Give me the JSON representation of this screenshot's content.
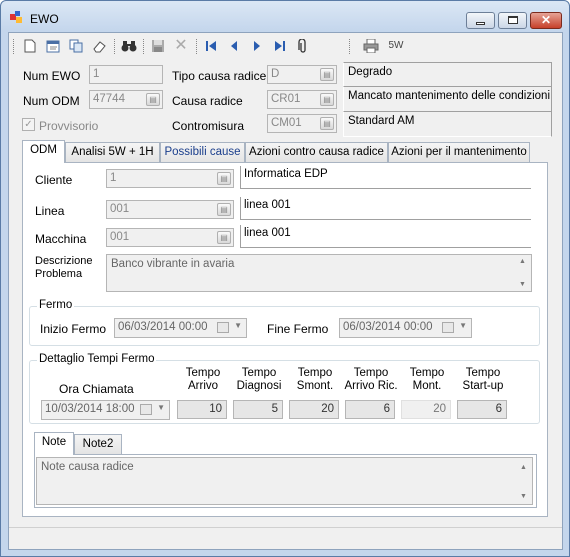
{
  "window": {
    "title": "EWO",
    "accent": "#c7402a"
  },
  "toolbar": {
    "tools": [
      "new-icon",
      "edit-icon",
      "copy-icon",
      "eraser-icon",
      "binoculars-icon",
      "save-icon",
      "delete-icon",
      "first-icon",
      "prev-icon",
      "next-icon",
      "last-icon",
      "attach-icon",
      "printer-icon"
    ],
    "fivew_label": "5W"
  },
  "header": {
    "num_ewo_label": "Num EWO",
    "num_ewo_value": "1",
    "num_odm_label": "Num ODM",
    "num_odm_value": "47744",
    "provvisorio_label": "Provvisorio",
    "tipo_causa_label": "Tipo causa radice",
    "tipo_causa_code": "D",
    "tipo_causa_desc": "Degrado",
    "causa_label": "Causa radice",
    "causa_code": "CR01",
    "causa_desc": "Mancato mantenimento delle condizioni di",
    "contromisura_label": "Contromisura",
    "contromisura_code": "CM01",
    "contromisura_desc": "Standard AM"
  },
  "tabs": [
    "ODM",
    "Analisi 5W + 1H",
    "Possibili cause",
    "Azioni contro causa radice",
    "Azioni per il mantenimento"
  ],
  "odm": {
    "cliente_label": "Cliente",
    "cliente_code": "1",
    "cliente_desc": "Informatica EDP",
    "linea_label": "Linea",
    "linea_code": "001",
    "linea_desc": "linea 001",
    "macchina_label": "Macchina",
    "macchina_code": "001",
    "macchina_desc": "linea 001",
    "descrizione_label_1": "Descrizione",
    "descrizione_label_2": "Problema",
    "descrizione_value": "Banco vibrante in avaria"
  },
  "fermo": {
    "title": "Fermo",
    "inizio_label": "Inizio Fermo",
    "inizio_value": "06/03/2014 00:00",
    "fine_label": "Fine Fermo",
    "fine_value": "06/03/2014 00:00"
  },
  "tempi": {
    "title": "Dettaglio Tempi Fermo",
    "ora_label": "Ora Chiamata",
    "ora_value": "10/03/2014 18:00",
    "columns": [
      {
        "l1": "Tempo",
        "l2": "Arrivo",
        "value": "10"
      },
      {
        "l1": "Tempo",
        "l2": "Diagnosi",
        "value": "5"
      },
      {
        "l1": "Tempo",
        "l2": "Smont.",
        "value": "20"
      },
      {
        "l1": "Tempo",
        "l2": "Arrivo Ric.",
        "value": "6"
      },
      {
        "l1": "Tempo",
        "l2": "Mont.",
        "value": "20"
      },
      {
        "l1": "Tempo",
        "l2": "Start-up",
        "value": "6"
      }
    ]
  },
  "notes": {
    "tabs": [
      "Note",
      "Note2"
    ],
    "value": "Note causa radice"
  }
}
